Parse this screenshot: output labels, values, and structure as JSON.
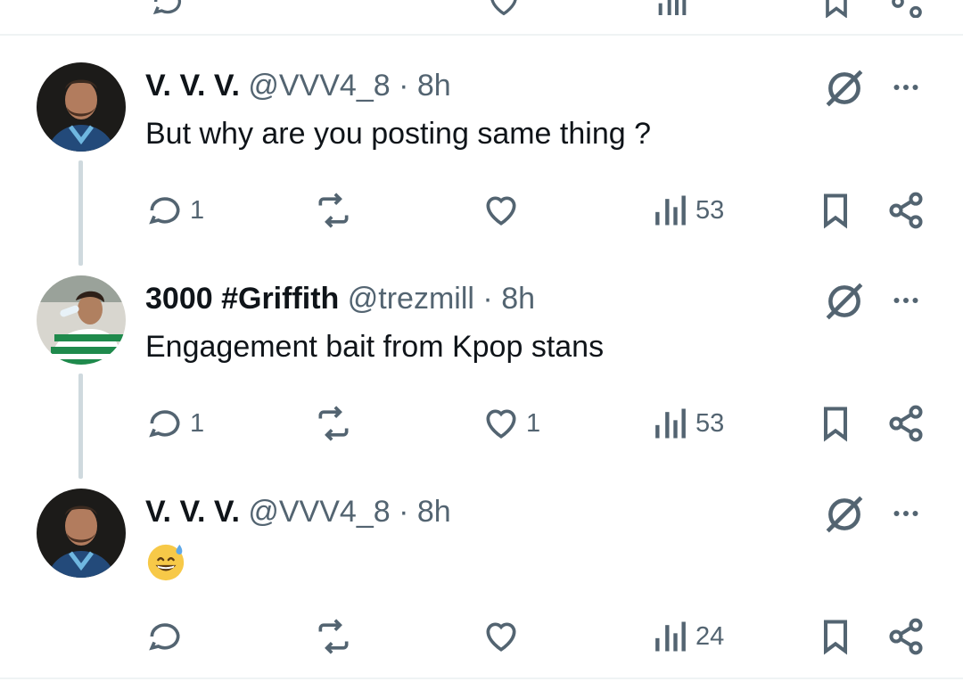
{
  "tweets": [
    {
      "display_name": "V. V. V.",
      "handle": "@VVV4_8",
      "separator": "·",
      "time": "8h",
      "text": "But why are you posting same thing ?",
      "reply_count": "1",
      "retweet_count": "",
      "like_count": "",
      "view_count": "53",
      "avatar": "messi-portrait"
    },
    {
      "display_name": "3000 #Griffith",
      "handle": "@trezmill",
      "separator": "·",
      "time": "8h",
      "text": "Engagement bait from Kpop stans",
      "reply_count": "1",
      "retweet_count": "",
      "like_count": "1",
      "view_count": "53",
      "avatar": "green-jersey-player"
    },
    {
      "display_name": "V. V. V.",
      "handle": "@VVV4_8",
      "separator": "·",
      "time": "8h",
      "text": "",
      "emoji": "grinning-face-with-sweat",
      "reply_count": "",
      "retweet_count": "",
      "like_count": "",
      "view_count": "24",
      "avatar": "messi-portrait"
    }
  ],
  "colors": {
    "text_primary": "#0f1419",
    "text_secondary": "#536471",
    "thread_line": "#cfd9de",
    "divider": "#eff3f4"
  }
}
